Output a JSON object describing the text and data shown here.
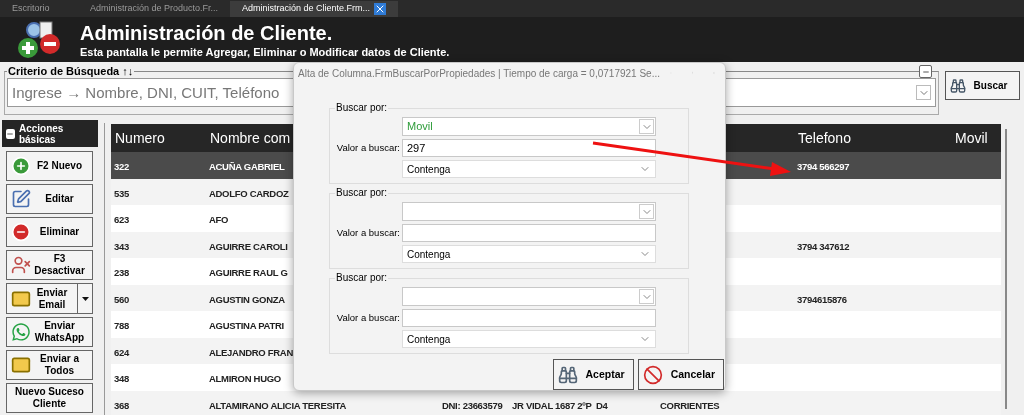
{
  "tabs": [
    {
      "label": "Escritorio",
      "selected": false
    },
    {
      "label": "Administración de Producto.Fr...",
      "selected": false
    },
    {
      "label": "Administración de Cliente.Frm...",
      "selected": true
    }
  ],
  "header": {
    "title": "Administración de Cliente.",
    "subtitle": "Esta pantalla le permite Agregar, Eliminar o Modificar datos de Cliente."
  },
  "search": {
    "group_label": "Criterio de Búsqueda ↑↓",
    "placeholder": "Ingrese → Nombre, DNI, CUIT, Teléfono",
    "button": "Buscar"
  },
  "actions": {
    "title": "Acciones básicas",
    "buttons": [
      {
        "label": "F2 Nuevo",
        "kind": "plain"
      },
      {
        "label": "Editar",
        "kind": "plain"
      },
      {
        "label": "Eliminar",
        "kind": "plain"
      },
      {
        "label": "F3 Desactivar",
        "kind": "plain"
      },
      {
        "label": "Enviar Email",
        "kind": "split"
      },
      {
        "label": "Enviar WhatsApp",
        "kind": "plain"
      },
      {
        "label": "Enviar a Todos",
        "kind": "plain"
      },
      {
        "label": "Nuevo Suceso Cliente",
        "kind": "text"
      }
    ]
  },
  "table": {
    "columns": [
      "Numero",
      "Nombre com",
      null,
      null,
      null,
      "Telefono",
      "Movil"
    ],
    "rows": [
      {
        "cells": [
          "322",
          "ACUÑA GABRIEL",
          null,
          null,
          null,
          "3794 566297",
          null
        ],
        "selected": true
      },
      {
        "cells": [
          "535",
          "ADOLFO CARDOZ",
          null,
          null,
          null,
          null,
          null
        ],
        "selected": false
      },
      {
        "cells": [
          "623",
          "AFO",
          null,
          null,
          null,
          null,
          null
        ],
        "selected": false
      },
      {
        "cells": [
          "343",
          "AGUIRRE CAROLI",
          null,
          null,
          null,
          "3794 347612",
          null
        ],
        "selected": false
      },
      {
        "cells": [
          "238",
          "AGUIRRE RAUL G",
          null,
          null,
          null,
          null,
          null
        ],
        "selected": false
      },
      {
        "cells": [
          "560",
          "AGUSTIN GONZA",
          null,
          null,
          null,
          "3794615876",
          null
        ],
        "selected": false
      },
      {
        "cells": [
          "788",
          "AGUSTINA PATRI",
          null,
          null,
          null,
          null,
          null
        ],
        "selected": false
      },
      {
        "cells": [
          "624",
          "ALEJANDRO FRAN",
          null,
          null,
          null,
          null,
          null
        ],
        "selected": false
      },
      {
        "cells": [
          "348",
          "ALMIRON HUGO",
          null,
          null,
          null,
          null,
          null
        ],
        "selected": false
      },
      {
        "cells": [
          "368",
          "ALTAMIRANO ALICIA TERESITA",
          "DNI: 23663579",
          "JR VIDAL 1687 2ºP  D4",
          "CORRIENTES",
          null,
          null
        ],
        "selected": false
      }
    ]
  },
  "dialog": {
    "title": "Alta de Columna.FrmBuscarPorPropiedades | Tiempo de carga = 0,0717921 Se...",
    "groups": [
      {
        "legend": "Buscar por:",
        "field": "Movil",
        "value_label": "Valor a buscar:",
        "value": "297",
        "operator": "Contenga"
      },
      {
        "legend": "Buscar por:",
        "value_label": "Valor a buscar:",
        "operator": "Contenga"
      },
      {
        "legend": "Buscar por:",
        "value_label": "Valor a buscar:",
        "operator": "Contenga"
      }
    ],
    "buttons": [
      {
        "label": "Aceptar",
        "kind": "search"
      },
      {
        "label": "Cancelar",
        "kind": "cancel"
      }
    ]
  }
}
